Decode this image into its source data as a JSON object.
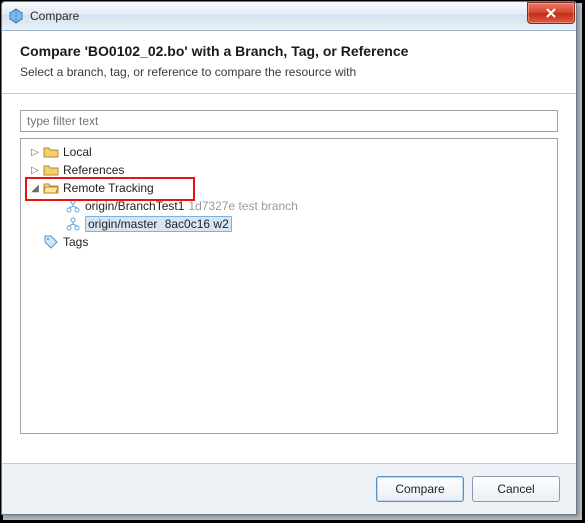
{
  "window": {
    "title": "Compare"
  },
  "header": {
    "heading": "Compare 'BO0102_02.bo' with a Branch, Tag, or Reference",
    "subtitle": "Select a branch, tag, or reference to compare the resource with"
  },
  "filter": {
    "placeholder": "type filter text",
    "value": ""
  },
  "tree": {
    "local": {
      "label": "Local",
      "expanded": false
    },
    "references": {
      "label": "References",
      "expanded": false
    },
    "remote": {
      "label": "Remote Tracking",
      "expanded": true,
      "items": [
        {
          "name": "origin/BranchTest1",
          "info": "1d7327e test branch",
          "selected": false
        },
        {
          "name": "origin/master",
          "info": "8ac0c16 w2",
          "selected": true
        }
      ]
    },
    "tags": {
      "label": "Tags",
      "expanded": false
    }
  },
  "buttons": {
    "compare": "Compare",
    "cancel": "Cancel"
  },
  "highlight": {
    "target": "Remote Tracking"
  }
}
